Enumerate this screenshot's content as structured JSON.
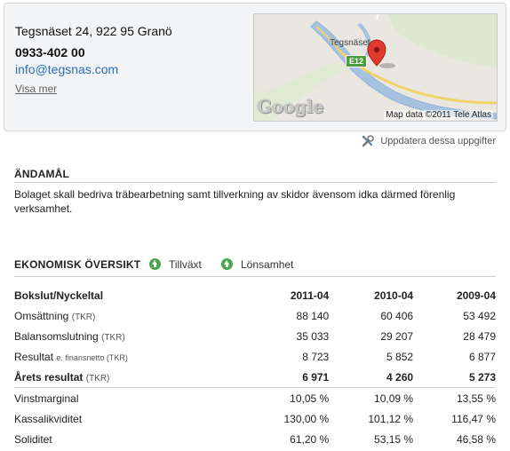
{
  "company": {
    "address": "Tegsnäset 24, 922 95 Granö",
    "phone": "0933-402 00",
    "email": "info@tegsnas.com",
    "more_link": "Visa mer"
  },
  "map": {
    "place_label": "Tegsnäset",
    "road_label": "E12",
    "logo": "Google",
    "credit": "Map data ©2011 Tele Atlas"
  },
  "update_link": "Uppdatera dessa uppgifter",
  "purpose": {
    "heading": "ÄNDAMÅL",
    "text": "Bolaget skall bedriva träbearbetning samt tillverkning av skidor ävensom idka därmed förenlig verksamhet."
  },
  "overview": {
    "heading": "EKONOMISK ÖVERSIKT",
    "legend": [
      "Tillväxt",
      "Lönsamhet"
    ],
    "columns": [
      "Bokslut/Nyckeltal",
      "2011-04",
      "2010-04",
      "2009-04"
    ],
    "rows": [
      {
        "label": "Omsättning",
        "unit": "(TKR)",
        "values": [
          "88 140",
          "60 406",
          "53 492"
        ]
      },
      {
        "label": "Balansomslutning",
        "unit": "(TKR)",
        "values": [
          "35 033",
          "29 207",
          "28 479"
        ]
      },
      {
        "label": "Resultat",
        "unit": "e. finansnetto (TKR)",
        "values": [
          "8 723",
          "5 852",
          "6 877"
        ]
      },
      {
        "label": "Årets resultat",
        "unit": "(TKR)",
        "values": [
          "6 971",
          "4 260",
          "5 273"
        ]
      }
    ],
    "ratios": [
      {
        "label": "Vinstmarginal",
        "values": [
          "10,05 %",
          "10,09 %",
          "13,55 %"
        ]
      },
      {
        "label": "Kassalikviditet",
        "values": [
          "130,00 %",
          "101,12 %",
          "116,47 %"
        ]
      },
      {
        "label": "Soliditet",
        "values": [
          "61,20 %",
          "53,15 %",
          "46,58 %"
        ]
      }
    ]
  },
  "colors": {
    "link": "#2a6ebb",
    "card_bg": "#f3f4f6",
    "legend_icon": "#4aa64a",
    "road_sign": "#4c9c3c",
    "marker": "#e03a2e"
  }
}
